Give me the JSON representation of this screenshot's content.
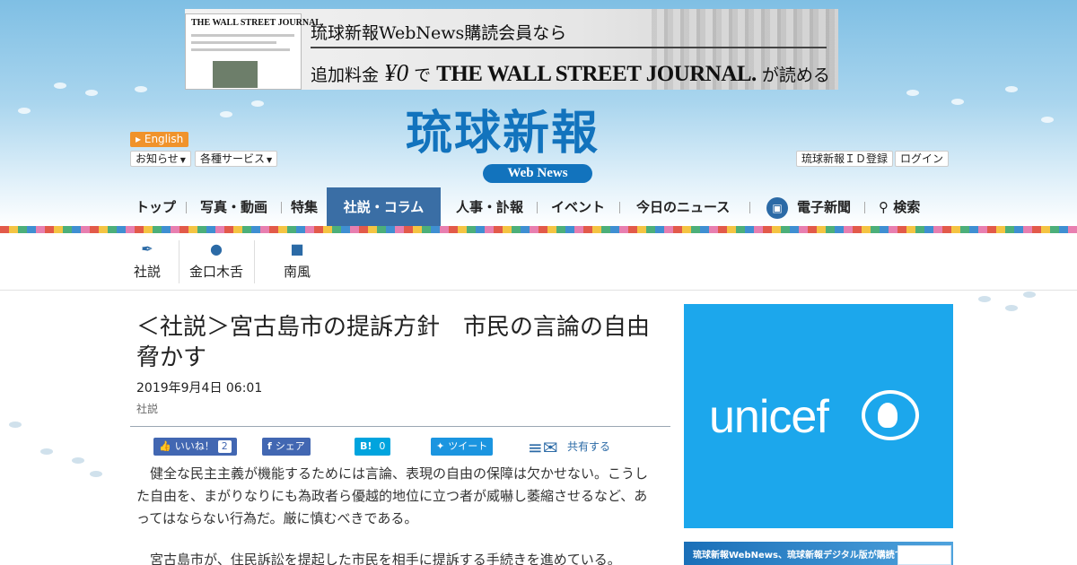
{
  "ad_banner": {
    "screenshot_title": "THE WALL STREET JOURNAL.",
    "line1": "琉球新報WebNews購読会員なら",
    "line2_prefix": "追加料金",
    "line2_price": "¥0",
    "line2_de": "で",
    "line2_wsj": "THE WALL STREET JOURNAL.",
    "line2_suffix": "が読める"
  },
  "header": {
    "logo": "琉球新報",
    "logo_sub": "Web News",
    "english_link": "English",
    "news_dropdown": "お知らせ",
    "services_dropdown": "各種サービス",
    "id_register": "琉球新報ＩＤ登録",
    "login": "ログイン"
  },
  "nav": {
    "items": [
      "トップ",
      "写真・動画",
      "特集",
      "社説・コラム",
      "人事・訃報",
      "イベント",
      "今日のニュース",
      "電子新聞",
      "検索"
    ],
    "active": "社説・コラム"
  },
  "subnav": {
    "items": [
      {
        "label": "社説",
        "icon": "pen-icon"
      },
      {
        "label": "金口木舌",
        "icon": "speech-bubble-icon"
      },
      {
        "label": "南風",
        "icon": "message-icon"
      }
    ]
  },
  "article": {
    "title": "＜社説＞宮古島市の提訴方針　市民の言論の自由脅かす",
    "date": "2019年9月4日 06:01",
    "category": "社説",
    "paragraphs": [
      "健全な民主主義が機能するためには言論、表現の自由の保障は欠かせない。こうした自由を、まがりなりにも為政者ら優越的地位に立つ者が威嚇し萎縮させるなど、あってはならない行為だ。厳に慎むべきである。",
      "宮古島市が、住民訴訟を提起した市民を相手に提訴する手続きを進めている。"
    ]
  },
  "share": {
    "fb_like_label": "いいね！",
    "fb_like_count": "2",
    "fb_share_label": "シェア",
    "hatena_label": "B!",
    "hatena_count": "0",
    "tweet_label": "ツイート",
    "share_all_label": "共有する"
  },
  "sidebar": {
    "unicef_text": "unicef",
    "ryukyu_ad_text": "琉球新報WebNews、琉球新報デジタル版が購読できる"
  },
  "colors": {
    "brand_blue": "#1273bd",
    "nav_active": "#3a6ea5",
    "facebook": "#4267b2",
    "twitter": "#1b95e0",
    "hatena": "#00a4de",
    "unicef": "#1ca7ec",
    "english_badge": "#f0932b"
  }
}
